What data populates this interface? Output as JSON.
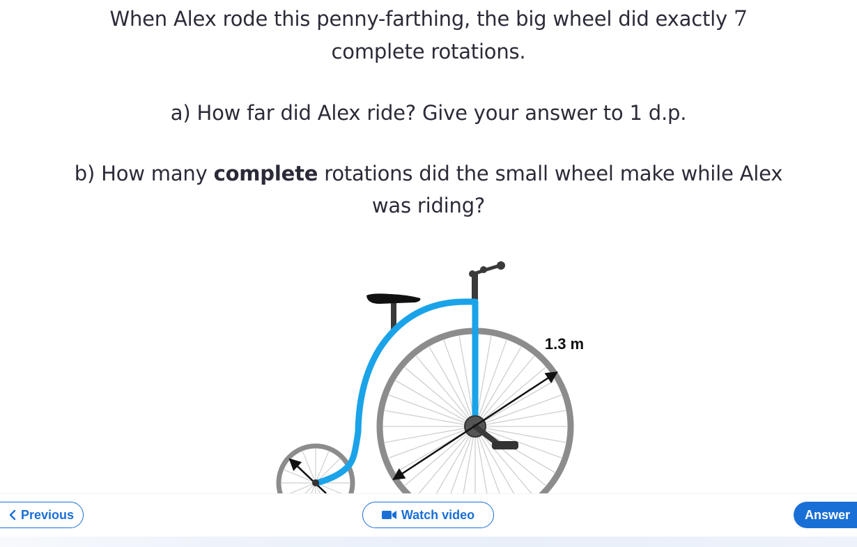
{
  "question": {
    "line1_before": "When Alex rode this penny-farthing, the big wheel did exactly ",
    "line1_number": "7",
    "line2": "complete rotations.",
    "part_a": "a) How far did Alex ride? Give your answer to 1 d.p.",
    "part_b_before": "b) How many ",
    "part_b_bold": "complete",
    "part_b_after": " rotations did the small wheel make while Alex",
    "part_b_line2": "was riding?"
  },
  "figure": {
    "big_wheel_label": "1.3 m",
    "frame_color": "#1aa3e8",
    "tyre_color": "#8c8c8c"
  },
  "nav": {
    "previous_label": "Previous",
    "watch_video_label": "Watch video",
    "answer_label": "Answer",
    "accent_color": "#1a6fd6"
  }
}
